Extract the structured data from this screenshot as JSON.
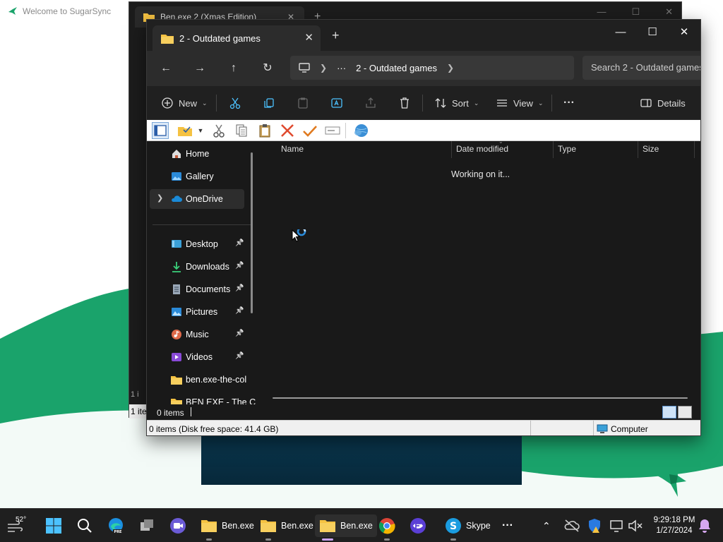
{
  "sugarsync": {
    "title": "Welcome to SugarSync",
    "colors": {
      "green": "#1aa36b",
      "light_green": "#d8eee2",
      "dark_panel": "#07283a"
    }
  },
  "bg_window": {
    "tab_title": "Ben.exe 2 (Xmas Edition)",
    "status_fragment": "1 ite",
    "side_fragment": "1 i"
  },
  "window": {
    "tab_title": "2 - Outdated games",
    "new_tab": "+",
    "controls": {
      "minimize": "—",
      "maximize": "☐",
      "close": "✕"
    },
    "address": {
      "ellipsis": "···",
      "current": "2 - Outdated games",
      "search_placeholder": "Search 2 - Outdated games"
    },
    "toolbar": {
      "new_label": "New",
      "sort_label": "Sort",
      "view_label": "View",
      "more_label": "···",
      "details_label": "Details"
    },
    "nav": [
      {
        "label": "Home",
        "icon": "home-icon",
        "pinned": false
      },
      {
        "label": "Gallery",
        "icon": "gallery-icon",
        "pinned": false
      },
      {
        "label": "OneDrive",
        "icon": "cloud-icon",
        "pinned": false
      },
      {
        "label": "Desktop",
        "icon": "desktop-icon",
        "pinned": true
      },
      {
        "label": "Downloads",
        "icon": "download-icon",
        "pinned": true
      },
      {
        "label": "Documents",
        "icon": "document-icon",
        "pinned": true
      },
      {
        "label": "Pictures",
        "icon": "pictures-icon",
        "pinned": true
      },
      {
        "label": "Music",
        "icon": "music-icon",
        "pinned": true
      },
      {
        "label": "Videos",
        "icon": "video-icon",
        "pinned": true
      },
      {
        "label": "ben.exe-the-col",
        "icon": "folder-icon",
        "pinned": false
      },
      {
        "label": "BEN EXE - The C",
        "icon": "folder-icon",
        "pinned": false
      }
    ],
    "columns": {
      "name": "Name",
      "date_modified": "Date modified",
      "type": "Type",
      "size": "Size"
    },
    "loading_text": "Working on it...",
    "item_count": "0 items",
    "statusbar": {
      "disk_info": "0 items (Disk free space: 41.4 GB)",
      "zone": "Computer"
    }
  },
  "taskbar": {
    "weather_temp": "52°",
    "apps": [
      {
        "label": "Ben.exe",
        "icon": "folder-icon"
      },
      {
        "label": "Ben.exe",
        "icon": "folder-icon"
      },
      {
        "label": "Ben.exe",
        "icon": "folder-icon"
      },
      {
        "label": "Skype",
        "icon": "skype-icon"
      }
    ],
    "more": "···",
    "time": "9:29:18 PM",
    "date": "1/27/2024"
  },
  "accent": "#4cc2ff",
  "folder_color": "#f5c242"
}
